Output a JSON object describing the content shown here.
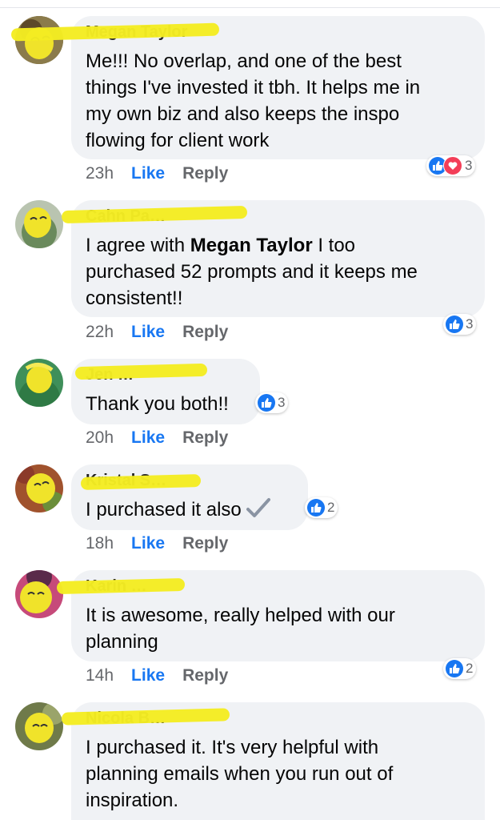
{
  "comments": [
    {
      "name": "Megan Taylor",
      "lines": [
        "Me!!! No overlap, and one of the best",
        "things I've invested it tbh. It helps me in",
        "my own biz and also keeps the inspo",
        "flowing for client work"
      ],
      "time": "23h",
      "like": "Like",
      "reply": "Reply",
      "reactions": {
        "types": [
          "like-icon",
          "love-icon"
        ],
        "count": "3"
      }
    },
    {
      "name": "Cahn Pa…",
      "mention": "Megan Taylor",
      "lines": [
        "I agree with ",
        " I too",
        "purchased 52 prompts and it keeps me",
        "consistent!!"
      ],
      "time": "22h",
      "like": "Like",
      "reply": "Reply",
      "reactions": {
        "types": [
          "like-icon"
        ],
        "count": "3"
      }
    },
    {
      "name": "Jen …",
      "lines": [
        "Thank you both!!"
      ],
      "time": "20h",
      "like": "Like",
      "reply": "Reply",
      "reactions": {
        "types": [
          "like-icon"
        ],
        "count": "3"
      }
    },
    {
      "name": "Kristal S…",
      "lines": [
        "I purchased it also"
      ],
      "time": "18h",
      "like": "Like",
      "reply": "Reply",
      "reactions": {
        "types": [
          "like-icon"
        ],
        "count": "2"
      }
    },
    {
      "name": "Karin …",
      "lines": [
        "It is awesome, really helped with our",
        "planning"
      ],
      "time": "14h",
      "like": "Like",
      "reply": "Reply",
      "reactions": {
        "types": [
          "like-icon"
        ],
        "count": "2"
      }
    },
    {
      "name": "Nicola B…",
      "lines": [
        "I purchased it.  It's very helpful with",
        "planning emails when you run out of",
        "inspiration."
      ]
    }
  ],
  "colors": {
    "link": "#1877f2",
    "bubble": "#f0f2f5",
    "highlighter": "#f4ec22",
    "meta": "#65676b"
  }
}
